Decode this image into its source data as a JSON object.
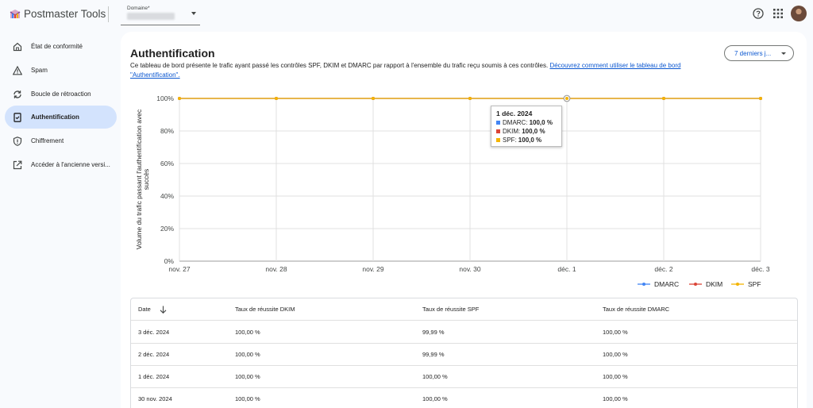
{
  "app": {
    "title": "Postmaster Tools"
  },
  "domain_select": {
    "label": "Domaine*"
  },
  "header_icons": [
    "help-icon",
    "apps-icon",
    "avatar"
  ],
  "sidebar": {
    "items": [
      {
        "label": "État de conformité",
        "icon": "home-icon",
        "active": false
      },
      {
        "label": "Spam",
        "icon": "warning-icon",
        "active": false
      },
      {
        "label": "Boucle de rétroaction",
        "icon": "sync-icon",
        "active": false
      },
      {
        "label": "Authentification",
        "icon": "verified-doc-icon",
        "active": true
      },
      {
        "label": "Chiffrement",
        "icon": "shield-icon",
        "active": false
      },
      {
        "label": "Accéder à l'ancienne versi...",
        "icon": "open-external-icon",
        "active": false
      }
    ]
  },
  "main": {
    "title": "Authentification",
    "description": "Ce tableau de bord présente le trafic ayant passé les contrôles SPF, DKIM et DMARC par rapport à l'ensemble du trafic reçu soumis à ces contrôles. ",
    "link_text": "Découvrez comment utiliser le tableau de bord \"Authentification\".",
    "range_button": "7 derniers j..."
  },
  "chart_data": {
    "type": "line",
    "x": [
      "nov. 27",
      "nov. 28",
      "nov. 29",
      "nov. 30",
      "déc. 1",
      "déc. 2",
      "déc. 3"
    ],
    "series": [
      {
        "name": "DMARC",
        "color": "#4285f4",
        "values": [
          100,
          100,
          100,
          100,
          100,
          100,
          100
        ]
      },
      {
        "name": "DKIM",
        "color": "#db4437",
        "values": [
          100,
          100,
          100,
          100,
          100,
          100,
          100
        ]
      },
      {
        "name": "SPF",
        "color": "#f4b400",
        "values": [
          100,
          100,
          100,
          100,
          100,
          100,
          100
        ]
      }
    ],
    "yticks": [
      "0%",
      "20%",
      "40%",
      "60%",
      "80%",
      "100%"
    ],
    "ylim": [
      0,
      100
    ],
    "ylabel_lines": [
      "Volume du trafic passant l'authentification avec",
      "succès"
    ],
    "grid": true,
    "legend_position": "bottom-right",
    "tooltip": {
      "title": "1 déc. 2024",
      "rows": [
        {
          "name": "DMARC",
          "value": "100,0 %",
          "color": "#4285f4"
        },
        {
          "name": "DKIM",
          "value": "100,0 %",
          "color": "#db4437"
        },
        {
          "name": "SPF",
          "value": "100,0 %",
          "color": "#f4b400"
        }
      ]
    }
  },
  "table": {
    "columns": [
      "Date",
      "Taux de réussite DKIM",
      "Taux de réussite SPF",
      "Taux de réussite DMARC"
    ],
    "rows": [
      [
        "3 déc. 2024",
        "100,00 %",
        "99,99 %",
        "100,00 %"
      ],
      [
        "2 déc. 2024",
        "100,00 %",
        "99,99 %",
        "100,00 %"
      ],
      [
        "1 déc. 2024",
        "100,00 %",
        "100,00 %",
        "100,00 %"
      ],
      [
        "30 nov. 2024",
        "100,00 %",
        "100,00 %",
        "100,00 %"
      ]
    ]
  }
}
